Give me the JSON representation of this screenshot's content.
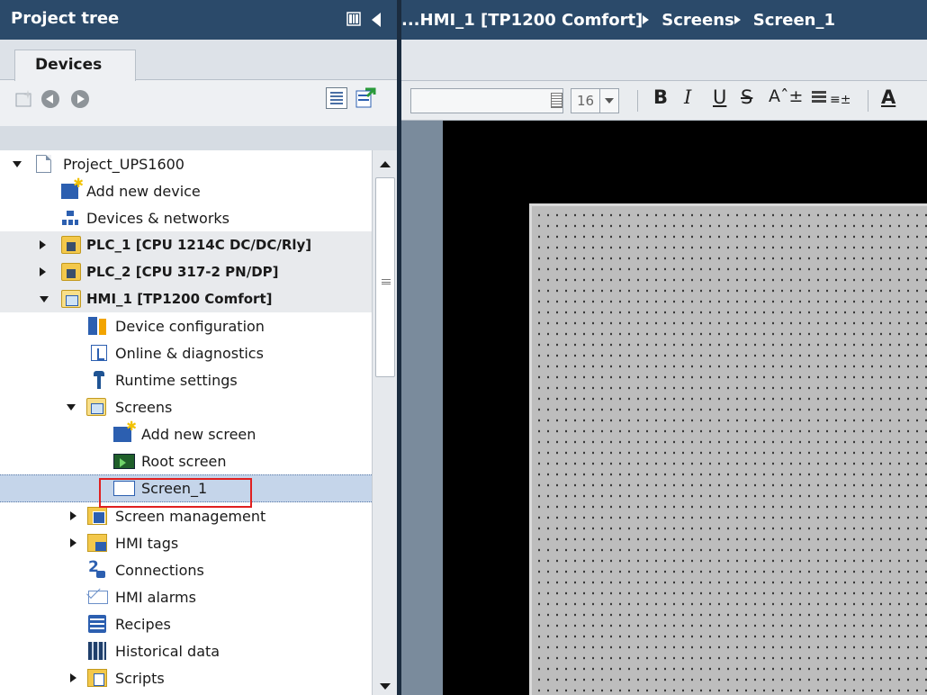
{
  "project_tree": {
    "title": "Project tree",
    "pin_icon": "pane-pin-icon",
    "collapse_icon": "collapse-left-icon",
    "tab": "Devices",
    "toolbar_icons": [
      "new-folder-icon",
      "back-icon",
      "forward-icon",
      "details-view-icon",
      "export-icon"
    ],
    "items": [
      {
        "label": "Project_UPS1600",
        "icon": "project-icon",
        "expander": "open",
        "bold": false
      },
      {
        "label": "Add new device",
        "icon": "add-device-icon",
        "expander": "none",
        "bold": false
      },
      {
        "label": "Devices & networks",
        "icon": "network-icon",
        "expander": "none",
        "bold": false
      },
      {
        "label": "PLC_1 [CPU 1214C DC/DC/Rly]",
        "icon": "plc-folder-icon",
        "expander": "closed",
        "bold": true
      },
      {
        "label": "PLC_2 [CPU 317-2 PN/DP]",
        "icon": "plc-folder-icon",
        "expander": "closed",
        "bold": true
      },
      {
        "label": "HMI_1 [TP1200 Comfort]",
        "icon": "hmi-folder-icon",
        "expander": "open",
        "bold": true
      },
      {
        "label": "Device configuration",
        "icon": "device-config-icon",
        "expander": "none",
        "bold": false
      },
      {
        "label": "Online & diagnostics",
        "icon": "diagnostics-icon",
        "expander": "none",
        "bold": false
      },
      {
        "label": "Runtime settings",
        "icon": "runtime-settings-icon",
        "expander": "none",
        "bold": false
      },
      {
        "label": "Screens",
        "icon": "folder-open-icon",
        "expander": "open",
        "bold": false
      },
      {
        "label": "Add new screen",
        "icon": "add-screen-icon",
        "expander": "none",
        "bold": false
      },
      {
        "label": "Root screen",
        "icon": "root-screen-icon",
        "expander": "none",
        "bold": false
      },
      {
        "label": "Screen_1",
        "icon": "screen-icon",
        "expander": "none",
        "bold": false,
        "selected": true
      },
      {
        "label": "Screen management",
        "icon": "screen-management-icon",
        "expander": "closed",
        "bold": false
      },
      {
        "label": "HMI tags",
        "icon": "hmi-tags-icon",
        "expander": "closed",
        "bold": false
      },
      {
        "label": "Connections",
        "icon": "connections-icon",
        "expander": "none",
        "bold": false
      },
      {
        "label": "HMI alarms",
        "icon": "alarms-icon",
        "expander": "none",
        "bold": false
      },
      {
        "label": "Recipes",
        "icon": "recipes-icon",
        "expander": "none",
        "bold": false
      },
      {
        "label": "Historical data",
        "icon": "historical-data-icon",
        "expander": "none",
        "bold": false
      },
      {
        "label": "Scripts",
        "icon": "scripts-icon",
        "expander": "closed",
        "bold": false
      }
    ]
  },
  "editor": {
    "breadcrumb": [
      "...HMI_1 [TP1200 Comfort]",
      "Screens",
      "Screen_1"
    ],
    "format_toolbar": {
      "font_name": "",
      "font_size": "16",
      "bold": "B",
      "italic": "I",
      "underline": "U",
      "strikethrough": "S",
      "grow_font": "Aˆ±",
      "align": "≡±",
      "font_color": "A"
    }
  },
  "colors": {
    "header_bg": "#2b4a6a",
    "selection_bg": "#c5d5ea",
    "highlight_border": "#e02020",
    "canvas_bg": "#000000",
    "screen_bg": "#bdbdbd"
  }
}
